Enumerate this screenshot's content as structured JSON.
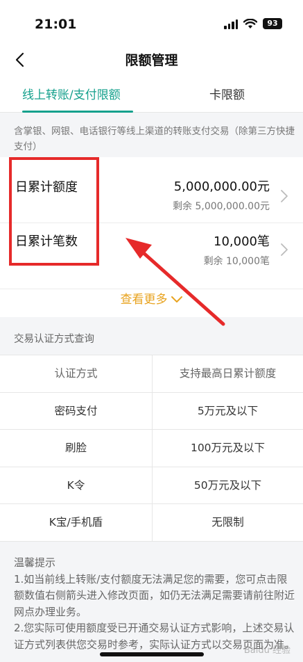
{
  "status_bar": {
    "time": "21:01",
    "battery": "93"
  },
  "nav": {
    "title": "限额管理"
  },
  "tabs": [
    {
      "label": "线上转账/支付限额",
      "active": true
    },
    {
      "label": "卡限额",
      "active": false
    }
  ],
  "description": "含掌银、网银、电话银行等线上渠道的转账支付交易（除第三方快捷支付）",
  "limits": [
    {
      "label": "日累计额度",
      "value": "5,000,000.00元",
      "remaining": "剩余 5,000,000.00元"
    },
    {
      "label": "日累计笔数",
      "value": "10,000笔",
      "remaining": "剩余 10,000笔"
    }
  ],
  "see_more": "查看更多",
  "auth_section": {
    "title": "交易认证方式查询",
    "columns": [
      "认证方式",
      "支持最高日累计额度"
    ],
    "rows": [
      [
        "密码支付",
        "5万元及以下"
      ],
      [
        "刷脸",
        "100万元及以下"
      ],
      [
        "K令",
        "50万元及以下"
      ],
      [
        "K宝/手机盾",
        "无限制"
      ]
    ]
  },
  "tips": {
    "title": "温馨提示",
    "items": [
      "1.如当前线上转账/支付额度无法满足您的需要，您可点击限额数值右侧箭头进入修改页面，如仍无法满足需要请前往附近网点办理业务。",
      "2.您实际可使用额度受已开通交易认证方式影响，上述交易认证方式列表供您交易时参考，实际认证方式以交易页面为准。"
    ]
  },
  "watermark": "Baidu 经验",
  "colors": {
    "accent": "#14a08c",
    "see_more": "#e8a31f",
    "annotation": "#e62a2a"
  }
}
